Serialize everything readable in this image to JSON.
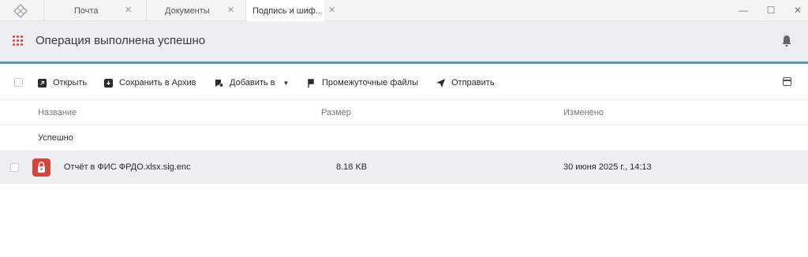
{
  "tabs": [
    {
      "label": "Почта",
      "close": "✕"
    },
    {
      "label": "Документы",
      "close": "✕"
    },
    {
      "label": "Подпись и шиф...",
      "close": "✕"
    }
  ],
  "window": {
    "minimize": "—",
    "maximize": "☐",
    "close": "✕"
  },
  "header": {
    "title": "Операция выполнена успешно",
    "accent_color": "#5d97a8",
    "apps_icon": "grid-icon",
    "bell_icon": "bell-icon"
  },
  "toolbar": {
    "open": "Открыть",
    "save_archive": "Сохранить в Архив",
    "add_to": "Добавить в",
    "intermediate_files": "Промежуточные файлы",
    "send": "Отправить"
  },
  "table": {
    "columns": {
      "name": "Название",
      "size": "Размер",
      "modified": "Изменено"
    },
    "group": "Успешно",
    "rows": [
      {
        "name": "Отчёт в ФИС ФРДО.xlsx.sig.enc",
        "size": "8.18 KB",
        "modified": "30 июня 2025 г., 14:13",
        "icon": "lock-icon",
        "icon_color": "#d9443a"
      }
    ]
  }
}
